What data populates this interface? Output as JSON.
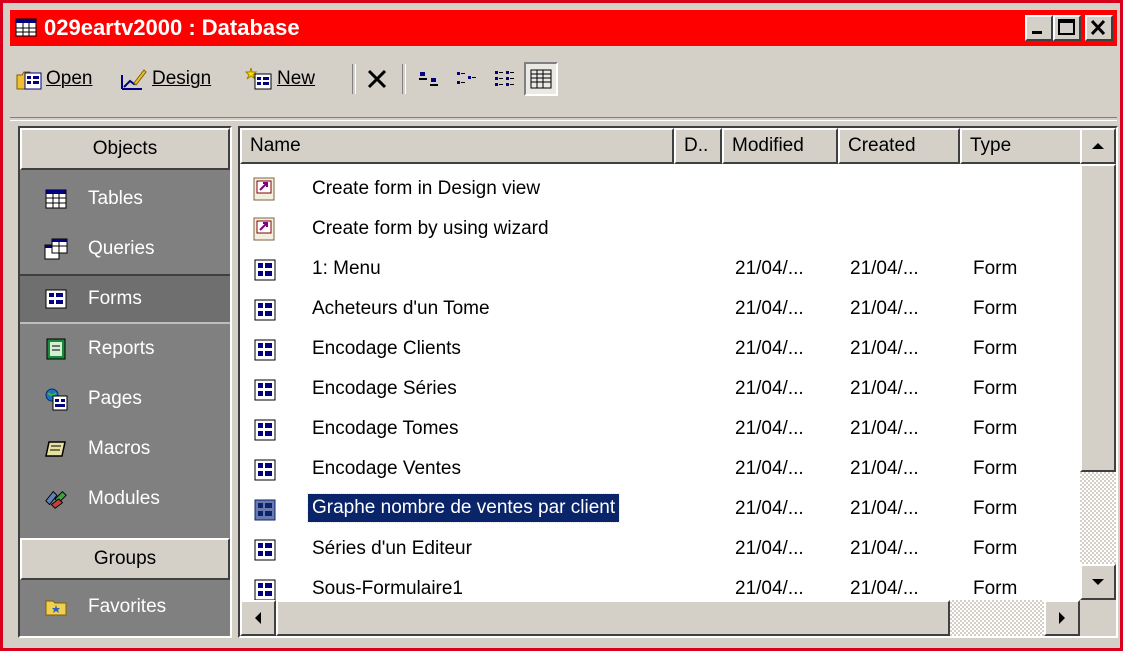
{
  "window": {
    "title": "029eartv2000 : Database",
    "title_bar_color": "#ff0000",
    "controls": [
      "minimize-icon",
      "maximize-icon",
      "close-icon"
    ]
  },
  "toolbar": {
    "open_label": "Open",
    "design_label": "Design",
    "new_label": "New",
    "icons": [
      "delete-icon",
      "large-icons-icon",
      "small-icons-icon",
      "list-view-icon",
      "details-view-icon"
    ]
  },
  "sidebar": {
    "objects_header": "Objects",
    "groups_header": "Groups",
    "items": [
      {
        "label": "Tables",
        "icon": "table-icon"
      },
      {
        "label": "Queries",
        "icon": "query-icon"
      },
      {
        "label": "Forms",
        "icon": "form-icon",
        "active": true
      },
      {
        "label": "Reports",
        "icon": "report-icon"
      },
      {
        "label": "Pages",
        "icon": "page-icon"
      },
      {
        "label": "Macros",
        "icon": "macro-icon"
      },
      {
        "label": "Modules",
        "icon": "module-icon"
      }
    ],
    "group_items": [
      {
        "label": "Favorites",
        "icon": "favorites-icon"
      }
    ]
  },
  "list": {
    "columns": [
      "Name",
      "D..",
      "Modified",
      "Created",
      "Type"
    ],
    "rows": [
      {
        "name": "Create form in Design view",
        "modified": "",
        "created": "",
        "type": "",
        "icon": "shortcut-icon"
      },
      {
        "name": "Create form by using wizard",
        "modified": "",
        "created": "",
        "type": "",
        "icon": "shortcut-icon"
      },
      {
        "name": "1: Menu",
        "modified": "21/04/...",
        "created": "21/04/...",
        "type": "Form",
        "icon": "form-icon"
      },
      {
        "name": "Acheteurs d'un Tome",
        "modified": "21/04/...",
        "created": "21/04/...",
        "type": "Form",
        "icon": "form-icon"
      },
      {
        "name": "Encodage Clients",
        "modified": "21/04/...",
        "created": "21/04/...",
        "type": "Form",
        "icon": "form-icon"
      },
      {
        "name": "Encodage Séries",
        "modified": "21/04/...",
        "created": "21/04/...",
        "type": "Form",
        "icon": "form-icon"
      },
      {
        "name": "Encodage Tomes",
        "modified": "21/04/...",
        "created": "21/04/...",
        "type": "Form",
        "icon": "form-icon"
      },
      {
        "name": "Encodage Ventes",
        "modified": "21/04/...",
        "created": "21/04/...",
        "type": "Form",
        "icon": "form-icon"
      },
      {
        "name": "Graphe nombre de ventes par client",
        "modified": "21/04/...",
        "created": "21/04/...",
        "type": "Form",
        "icon": "form-icon",
        "selected": true
      },
      {
        "name": "Séries d'un Editeur",
        "modified": "21/04/...",
        "created": "21/04/...",
        "type": "Form",
        "icon": "form-icon"
      },
      {
        "name": "Sous-Formulaire1",
        "modified": "21/04/...",
        "created": "21/04/...",
        "type": "Form",
        "icon": "form-icon"
      }
    ]
  },
  "colors": {
    "selection": "#0a246a",
    "face": "#d4d0c8",
    "sidebar_bg": "#808080"
  }
}
